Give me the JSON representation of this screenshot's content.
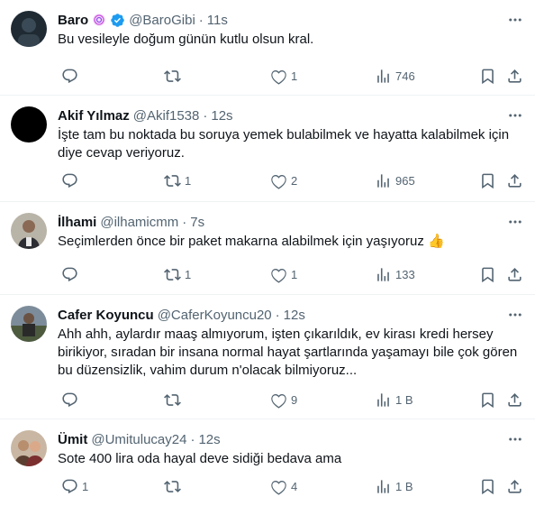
{
  "tweets": [
    {
      "name": "Baro",
      "handle": "@BaroGibi",
      "time": "11s",
      "text": "Bu vesileyle doğum günün kutlu olsun kral.",
      "replies": "",
      "retweets": "",
      "likes": "1",
      "views": "746",
      "badges": [
        "spiral-badge-icon",
        "verified-badge-icon"
      ]
    },
    {
      "name": "Akif Yılmaz",
      "handle": "@Akif1538",
      "time": "12s",
      "text": "İşte tam bu noktada bu soruya yemek bulabilmek ve hayatta kalabilmek için diye cevap veriyoruz.",
      "replies": "",
      "retweets": "1",
      "likes": "2",
      "views": "965"
    },
    {
      "name": "İlhami",
      "handle": "@ilhamicmm",
      "time": "7s",
      "text": "Seçimlerden önce bir paket makarna alabilmek için yaşıyoruz 👍",
      "replies": "",
      "retweets": "1",
      "likes": "1",
      "views": "133"
    },
    {
      "name": "Cafer Koyuncu",
      "handle": "@CaferKoyuncu20",
      "time": "12s",
      "text": "Ahh ahh, aylardır maaş almıyorum, işten çıkarıldık, ev kirası kredi hersey birikiyor, sıradan bir insana normal hayat şartlarında yaşamayı bile çok gören bu düzensizlik, vahim durum n'olacak bilmiyoruz...",
      "replies": "",
      "retweets": "",
      "likes": "9",
      "views": "1 B"
    },
    {
      "name": "Ümit",
      "handle": "@Umitulucay24",
      "time": "12s",
      "text": "Sote 400 lira oda hayal deve sidiği bedava ama",
      "replies": "1",
      "retweets": "",
      "likes": "4",
      "views": "1 B"
    }
  ],
  "colors": {
    "text": "#0f1419",
    "secondary": "#536471",
    "verified": "#1d9bf0",
    "border": "#eff3f4"
  }
}
